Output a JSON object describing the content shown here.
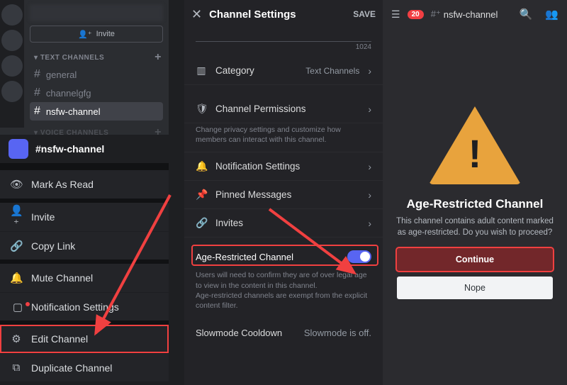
{
  "sidebar": {
    "invite_label": "Invite",
    "cat_text": "TEXT CHANNELS",
    "cat_voice": "VOICE CHANNELS",
    "channels": [
      {
        "label": "general"
      },
      {
        "label": "channelgfg"
      },
      {
        "label": "nsfw-channel"
      }
    ]
  },
  "context": {
    "channel_label": "#nsfw-channel",
    "items": {
      "mark_read": "Mark As Read",
      "invite": "Invite",
      "copy_link": "Copy Link",
      "mute": "Mute Channel",
      "notif": "Notification Settings",
      "edit": "Edit Channel",
      "duplicate": "Duplicate Channel"
    }
  },
  "settings": {
    "title": "Channel Settings",
    "save": "SAVE",
    "char_count": "1024",
    "rows": {
      "category": {
        "label": "Category",
        "value": "Text Channels"
      },
      "perm": {
        "label": "Channel Permissions"
      },
      "perm_desc": "Change privacy settings and customize how members can interact with this channel.",
      "notif": {
        "label": "Notification Settings"
      },
      "pinned": {
        "label": "Pinned Messages"
      },
      "invites": {
        "label": "Invites"
      }
    },
    "age": {
      "label": "Age-Restricted Channel",
      "desc": "Users will need to confirm they are of over legal age to view in the content in this channel.\nAge-restricted channels are exempt from the explicit content filter."
    },
    "slow": {
      "label": "Slowmode Cooldown",
      "value": "Slowmode is off."
    }
  },
  "right": {
    "mention_count": "20",
    "channel": "nsfw-channel",
    "warn_title": "Age-Restricted Channel",
    "warn_body": "This channel contains adult content marked as age-restricted. Do you wish to proceed?",
    "continue": "Continue",
    "nope": "Nope"
  }
}
